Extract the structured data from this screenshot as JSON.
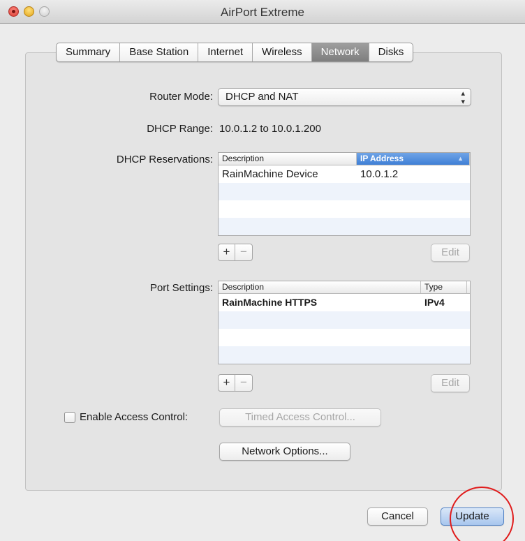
{
  "window": {
    "title": "AirPort Extreme"
  },
  "tabs": [
    {
      "label": "Summary",
      "active": false
    },
    {
      "label": "Base Station",
      "active": false
    },
    {
      "label": "Internet",
      "active": false
    },
    {
      "label": "Wireless",
      "active": false
    },
    {
      "label": "Network",
      "active": true
    },
    {
      "label": "Disks",
      "active": false
    }
  ],
  "router_mode": {
    "label": "Router Mode:",
    "value": "DHCP and NAT"
  },
  "dhcp_range": {
    "label": "DHCP Range:",
    "value": "10.0.1.2 to 10.0.1.200"
  },
  "dhcp_reservations": {
    "label": "DHCP Reservations:",
    "columns": [
      "Description",
      "IP Address"
    ],
    "rows": [
      {
        "description": "RainMachine Device",
        "ip": "10.0.1.2"
      }
    ],
    "edit_label": "Edit"
  },
  "port_settings": {
    "label": "Port Settings:",
    "columns": [
      "Description",
      "Type"
    ],
    "rows": [
      {
        "description": "RainMachine HTTPS",
        "type": "IPv4"
      }
    ],
    "edit_label": "Edit"
  },
  "access_control": {
    "checkbox_label": "Enable Access Control:",
    "checked": false,
    "timed_button": "Timed Access Control..."
  },
  "network_options_button": "Network Options...",
  "footer": {
    "cancel_label": "Cancel",
    "update_label": "Update"
  },
  "controls": {
    "plus": "+",
    "minus": "−"
  },
  "colors": {
    "annotation_circle": "#e01b1b",
    "selected_tab": "#8a8a8a",
    "sorted_column": "#4a88db"
  }
}
